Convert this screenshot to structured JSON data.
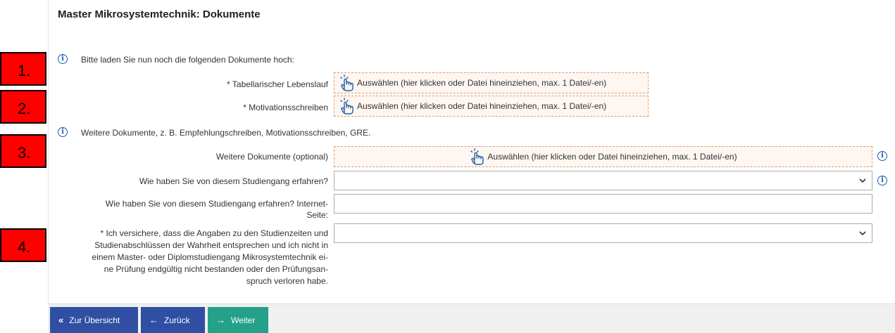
{
  "page": {
    "title": "Master Mikrosystemtechnik: Dokumente"
  },
  "markers": [
    "1.",
    "2.",
    "3.",
    "4."
  ],
  "hints": {
    "upload_intro": "Bitte laden Sie nun noch die folgenden Dokumente hoch:",
    "more_docs": "Weitere Dokumente, z. B. Empfehlungschreiben, Motivationsschreiben, GRE."
  },
  "fields": {
    "cv_label": "* Tabellarischer Lebenslauf",
    "motivation_label": "* Motivationsschreiben",
    "more_docs_label": "Weitere Dokumente (optional)",
    "source_label": "Wie haben Sie von diesem Studiengang erfahren?",
    "source_website_label_1": "Wie haben Sie von diesem Studiengang erfahren? Internet-",
    "source_website_label_2": "Seite:",
    "declaration_lines": [
      "* Ich versichere, dass die Angaben zu den Studienzeiten und",
      "Studienabschlüssen der Wahrheit entsprechen und ich nicht in",
      "einem Master- oder Diplomstudiengang Mikrosystemtechnik ei-",
      "ne Prüfung endgültig nicht bestanden oder den Prüfungsan-",
      "spruch verloren habe."
    ],
    "upload_text": "Auswählen (hier klicken oder Datei hineinziehen, max. 1 Datei/-en)",
    "source_value": "",
    "source_website_value": "",
    "declaration_value": ""
  },
  "buttons": {
    "overview": "Zur Übersicht",
    "back": "Zurück",
    "next": "Weiter"
  },
  "colors": {
    "button_blue": "#2e4fa2",
    "button_green": "#25a089",
    "upload_border": "#e39a66",
    "info_blue": "#1d5fa5",
    "marker_red": "#ff0000"
  },
  "icons": {
    "info": "info-circle-icon",
    "upload": "pointing-hand-icon",
    "select": "chevron-down-icon",
    "overview": "double-chevron-left-icon",
    "back": "arrow-left-icon",
    "next": "arrow-right-icon"
  }
}
